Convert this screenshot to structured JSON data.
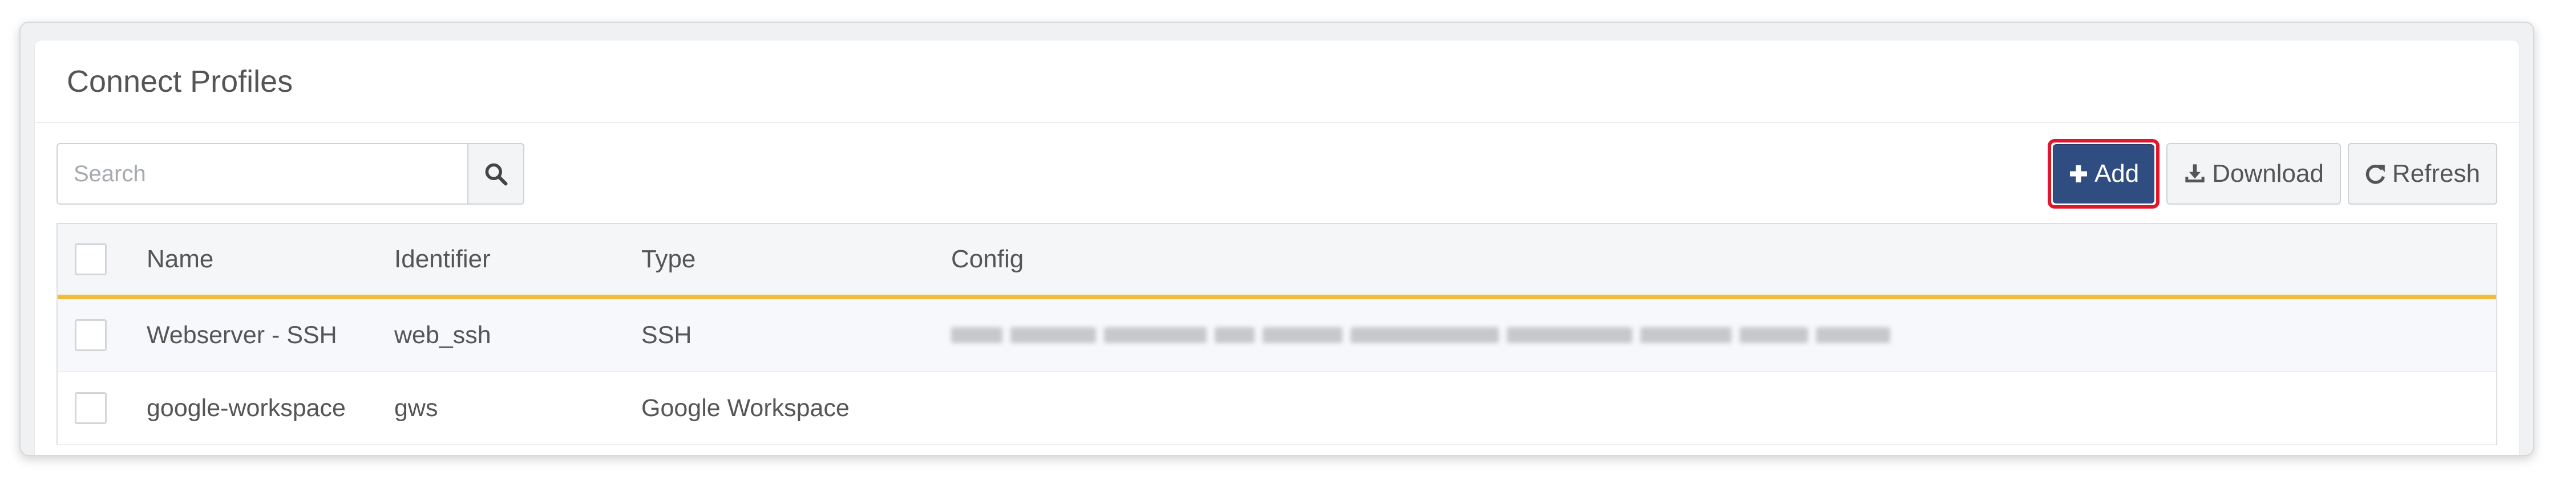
{
  "panel": {
    "title": "Connect Profiles"
  },
  "search": {
    "placeholder": "Search",
    "value": ""
  },
  "toolbar": {
    "add_label": "Add",
    "download_label": "Download",
    "refresh_label": "Refresh"
  },
  "icons": {
    "search": "search-icon",
    "add": "plus-icon",
    "download": "download-icon",
    "refresh": "refresh-icon"
  },
  "colors": {
    "add_button": "#2f4d80",
    "highlight_border": "#e0162b",
    "header_underline": "#f2bd3f"
  },
  "table": {
    "columns": [
      "Name",
      "Identifier",
      "Type",
      "Config"
    ],
    "rows": [
      {
        "name": "Webserver - SSH",
        "identifier": "web_ssh",
        "type": "SSH",
        "config": ""
      },
      {
        "name": "google-workspace",
        "identifier": "gws",
        "type": "Google Workspace",
        "config": ""
      }
    ]
  }
}
